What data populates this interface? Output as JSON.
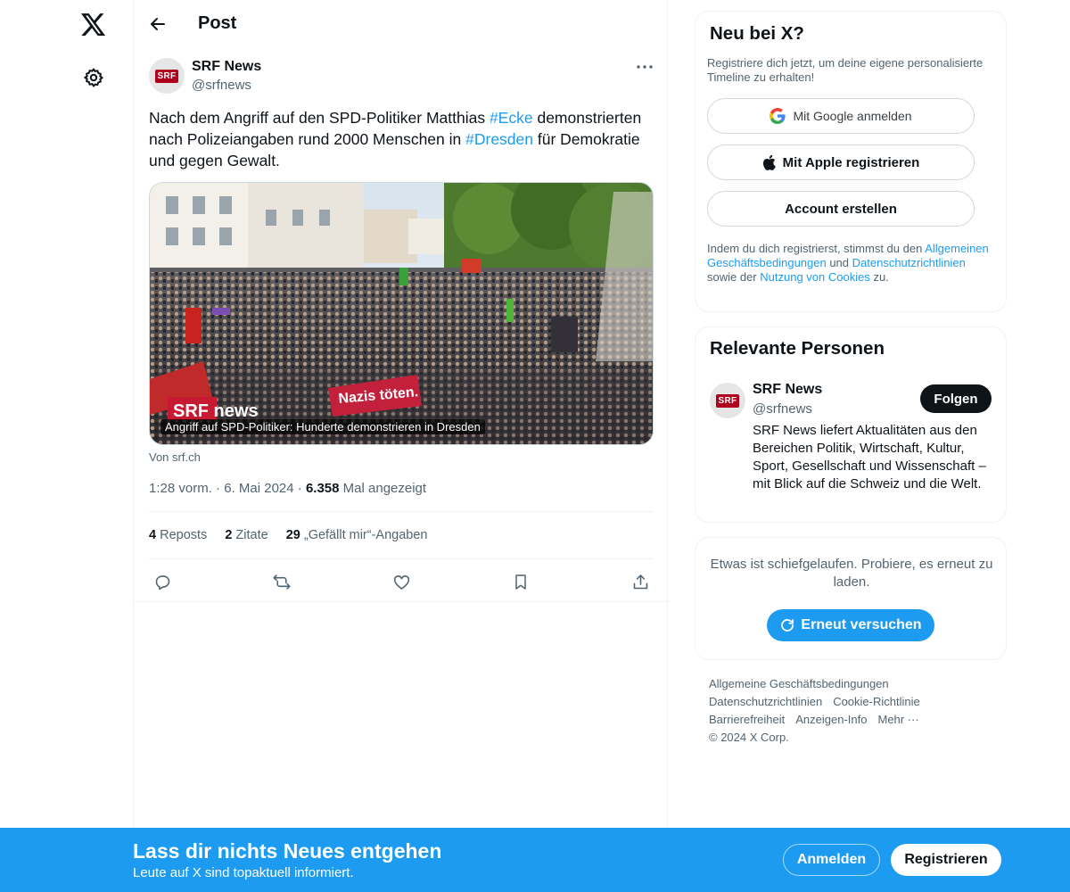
{
  "nav": {
    "logo_icon": "x-logo-icon",
    "settings_icon": "gear-icon"
  },
  "header": {
    "title": "Post"
  },
  "tweet": {
    "author_name": "SRF News",
    "author_handle": "@srfnews",
    "avatar_logo": "SRF",
    "text_parts": [
      "Nach dem Angriff auf den SPD-Politiker Matthias ",
      "#Ecke",
      " demonstrierten nach Polizeiangaben rund 2000 Menschen in ",
      "#Dresden",
      " für Demokratie und gegen Gewalt."
    ],
    "media_caption": "Angriff auf SPD-Politiker: Hunderte demonstrieren in Dresden",
    "media_watermark": "SRF news",
    "media_banner": "Nazis töten.",
    "media_source": "Von srf.ch",
    "time": "1:28 vorm.",
    "date": "6. Mai 2024",
    "views_count": "6.358",
    "views_label": "Mal angezeigt",
    "reposts_count": "4",
    "reposts_label": "Reposts",
    "quotes_count": "2",
    "quotes_label": "Zitate",
    "likes_count": "29",
    "likes_label": "„Gefällt mir“-Angaben"
  },
  "signup": {
    "title": "Neu bei X?",
    "description": "Registriere dich jetzt, um deine eigene personalisierte Timeline zu erhalten!",
    "google_label": "Mit Google anmelden",
    "apple_label": "Mit Apple registrieren",
    "create_label": "Account erstellen",
    "legal_prefix": "Indem du dich registrierst, stimmst du den ",
    "legal_terms": "Allgemeinen Geschäftsbedingungen",
    "legal_and": " und ",
    "legal_privacy": "Datenschutzrichtlinien",
    "legal_middle": " sowie der ",
    "legal_cookies": "Nutzung von Cookies",
    "legal_suffix": " zu."
  },
  "relevant": {
    "title": "Relevante Personen",
    "name": "SRF News",
    "handle": "@srfnews",
    "follow_label": "Folgen",
    "bio": "SRF News liefert Aktualitäten aus den Bereichen Politik, Wirtschaft, Kultur, Sport, Gesellschaft und Wissenschaft – mit Blick auf die Schweiz und die Welt."
  },
  "error_card": {
    "message": "Etwas ist schiefgelaufen. Probiere, es erneut zu laden.",
    "retry_label": "Erneut versuchen"
  },
  "footer": {
    "links": [
      "Allgemeine Geschäftsbedingungen",
      "Datenschutzrichtlinien",
      "Cookie-Richtlinie",
      "Barrierefreiheit",
      "Anzeigen-Info",
      "Mehr ···"
    ],
    "copyright": "© 2024 X Corp."
  },
  "bottom_bar": {
    "title": "Lass dir nichts Neues entgehen",
    "subtitle": "Leute auf X sind topaktuell informiert.",
    "login_label": "Anmelden",
    "register_label": "Registrieren"
  },
  "colors": {
    "accent": "#1d9bf0",
    "text": "#0f1419",
    "muted": "#536471",
    "srf_red": "#af001d"
  }
}
